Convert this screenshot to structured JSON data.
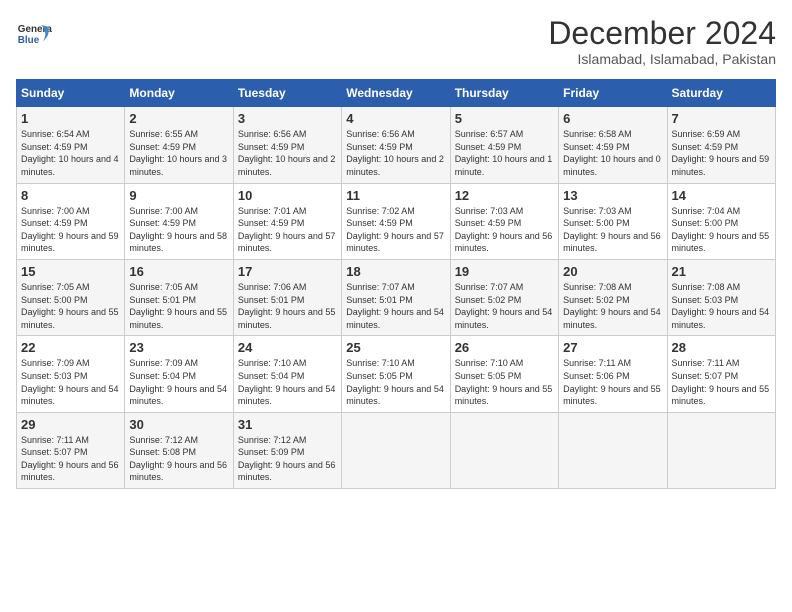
{
  "header": {
    "logo_line1": "General",
    "logo_line2": "Blue",
    "title": "December 2024",
    "subtitle": "Islamabad, Islamabad, Pakistan"
  },
  "weekdays": [
    "Sunday",
    "Monday",
    "Tuesday",
    "Wednesday",
    "Thursday",
    "Friday",
    "Saturday"
  ],
  "weeks": [
    [
      {
        "day": "1",
        "sunrise": "Sunrise: 6:54 AM",
        "sunset": "Sunset: 4:59 PM",
        "daylight": "Daylight: 10 hours and 4 minutes."
      },
      {
        "day": "2",
        "sunrise": "Sunrise: 6:55 AM",
        "sunset": "Sunset: 4:59 PM",
        "daylight": "Daylight: 10 hours and 3 minutes."
      },
      {
        "day": "3",
        "sunrise": "Sunrise: 6:56 AM",
        "sunset": "Sunset: 4:59 PM",
        "daylight": "Daylight: 10 hours and 2 minutes."
      },
      {
        "day": "4",
        "sunrise": "Sunrise: 6:56 AM",
        "sunset": "Sunset: 4:59 PM",
        "daylight": "Daylight: 10 hours and 2 minutes."
      },
      {
        "day": "5",
        "sunrise": "Sunrise: 6:57 AM",
        "sunset": "Sunset: 4:59 PM",
        "daylight": "Daylight: 10 hours and 1 minute."
      },
      {
        "day": "6",
        "sunrise": "Sunrise: 6:58 AM",
        "sunset": "Sunset: 4:59 PM",
        "daylight": "Daylight: 10 hours and 0 minutes."
      },
      {
        "day": "7",
        "sunrise": "Sunrise: 6:59 AM",
        "sunset": "Sunset: 4:59 PM",
        "daylight": "Daylight: 9 hours and 59 minutes."
      }
    ],
    [
      {
        "day": "8",
        "sunrise": "Sunrise: 7:00 AM",
        "sunset": "Sunset: 4:59 PM",
        "daylight": "Daylight: 9 hours and 59 minutes."
      },
      {
        "day": "9",
        "sunrise": "Sunrise: 7:00 AM",
        "sunset": "Sunset: 4:59 PM",
        "daylight": "Daylight: 9 hours and 58 minutes."
      },
      {
        "day": "10",
        "sunrise": "Sunrise: 7:01 AM",
        "sunset": "Sunset: 4:59 PM",
        "daylight": "Daylight: 9 hours and 57 minutes."
      },
      {
        "day": "11",
        "sunrise": "Sunrise: 7:02 AM",
        "sunset": "Sunset: 4:59 PM",
        "daylight": "Daylight: 9 hours and 57 minutes."
      },
      {
        "day": "12",
        "sunrise": "Sunrise: 7:03 AM",
        "sunset": "Sunset: 4:59 PM",
        "daylight": "Daylight: 9 hours and 56 minutes."
      },
      {
        "day": "13",
        "sunrise": "Sunrise: 7:03 AM",
        "sunset": "Sunset: 5:00 PM",
        "daylight": "Daylight: 9 hours and 56 minutes."
      },
      {
        "day": "14",
        "sunrise": "Sunrise: 7:04 AM",
        "sunset": "Sunset: 5:00 PM",
        "daylight": "Daylight: 9 hours and 55 minutes."
      }
    ],
    [
      {
        "day": "15",
        "sunrise": "Sunrise: 7:05 AM",
        "sunset": "Sunset: 5:00 PM",
        "daylight": "Daylight: 9 hours and 55 minutes."
      },
      {
        "day": "16",
        "sunrise": "Sunrise: 7:05 AM",
        "sunset": "Sunset: 5:01 PM",
        "daylight": "Daylight: 9 hours and 55 minutes."
      },
      {
        "day": "17",
        "sunrise": "Sunrise: 7:06 AM",
        "sunset": "Sunset: 5:01 PM",
        "daylight": "Daylight: 9 hours and 55 minutes."
      },
      {
        "day": "18",
        "sunrise": "Sunrise: 7:07 AM",
        "sunset": "Sunset: 5:01 PM",
        "daylight": "Daylight: 9 hours and 54 minutes."
      },
      {
        "day": "19",
        "sunrise": "Sunrise: 7:07 AM",
        "sunset": "Sunset: 5:02 PM",
        "daylight": "Daylight: 9 hours and 54 minutes."
      },
      {
        "day": "20",
        "sunrise": "Sunrise: 7:08 AM",
        "sunset": "Sunset: 5:02 PM",
        "daylight": "Daylight: 9 hours and 54 minutes."
      },
      {
        "day": "21",
        "sunrise": "Sunrise: 7:08 AM",
        "sunset": "Sunset: 5:03 PM",
        "daylight": "Daylight: 9 hours and 54 minutes."
      }
    ],
    [
      {
        "day": "22",
        "sunrise": "Sunrise: 7:09 AM",
        "sunset": "Sunset: 5:03 PM",
        "daylight": "Daylight: 9 hours and 54 minutes."
      },
      {
        "day": "23",
        "sunrise": "Sunrise: 7:09 AM",
        "sunset": "Sunset: 5:04 PM",
        "daylight": "Daylight: 9 hours and 54 minutes."
      },
      {
        "day": "24",
        "sunrise": "Sunrise: 7:10 AM",
        "sunset": "Sunset: 5:04 PM",
        "daylight": "Daylight: 9 hours and 54 minutes."
      },
      {
        "day": "25",
        "sunrise": "Sunrise: 7:10 AM",
        "sunset": "Sunset: 5:05 PM",
        "daylight": "Daylight: 9 hours and 54 minutes."
      },
      {
        "day": "26",
        "sunrise": "Sunrise: 7:10 AM",
        "sunset": "Sunset: 5:05 PM",
        "daylight": "Daylight: 9 hours and 55 minutes."
      },
      {
        "day": "27",
        "sunrise": "Sunrise: 7:11 AM",
        "sunset": "Sunset: 5:06 PM",
        "daylight": "Daylight: 9 hours and 55 minutes."
      },
      {
        "day": "28",
        "sunrise": "Sunrise: 7:11 AM",
        "sunset": "Sunset: 5:07 PM",
        "daylight": "Daylight: 9 hours and 55 minutes."
      }
    ],
    [
      {
        "day": "29",
        "sunrise": "Sunrise: 7:11 AM",
        "sunset": "Sunset: 5:07 PM",
        "daylight": "Daylight: 9 hours and 56 minutes."
      },
      {
        "day": "30",
        "sunrise": "Sunrise: 7:12 AM",
        "sunset": "Sunset: 5:08 PM",
        "daylight": "Daylight: 9 hours and 56 minutes."
      },
      {
        "day": "31",
        "sunrise": "Sunrise: 7:12 AM",
        "sunset": "Sunset: 5:09 PM",
        "daylight": "Daylight: 9 hours and 56 minutes."
      },
      null,
      null,
      null,
      null
    ]
  ]
}
